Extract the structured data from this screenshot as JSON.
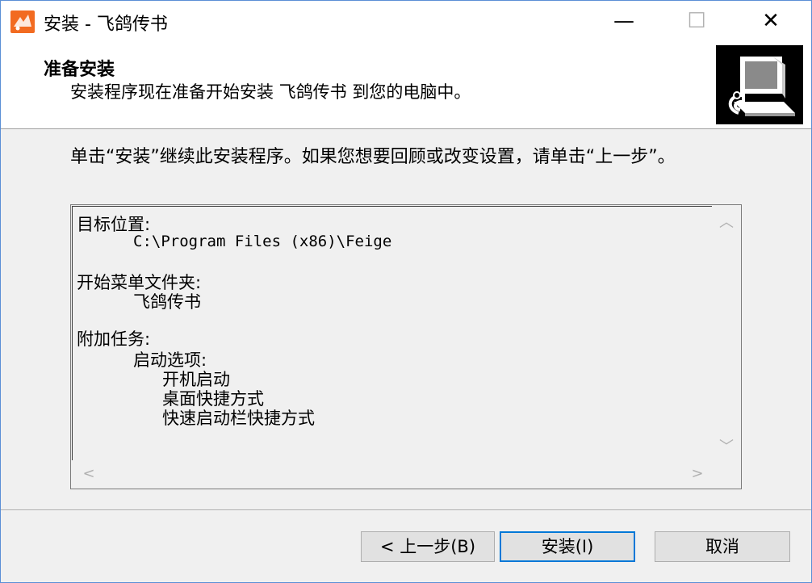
{
  "window": {
    "title": "安装 - 飞鸽传书",
    "minimize_glyph": "—",
    "maximize_glyph": "☐",
    "close_glyph": "✕"
  },
  "header": {
    "title": "准备安装",
    "subtitle": "安装程序现在准备开始安装 飞鸽传书 到您的电脑中。"
  },
  "instruction": "单击“安装”继续此安装程序。如果您想要回顾或改变设置，请单击“上一步”。",
  "memo": {
    "destination_label": "目标位置:",
    "destination_value": "C:\\Program Files (x86)\\Feige",
    "start_menu_label": "开始菜单文件夹:",
    "start_menu_value": "飞鸽传书",
    "tasks_label": "附加任务:",
    "tasks_group": "启动选项:",
    "tasks": [
      "开机启动",
      "桌面快捷方式",
      "快速启动栏快捷方式"
    ]
  },
  "buttons": {
    "back": "< 上一步(B)",
    "install": "安装(I)",
    "cancel": "取消"
  },
  "colors": {
    "app_icon": "#f26b21",
    "focus_border": "#0078d7",
    "window_border": "#5b8fd6"
  },
  "icons": {
    "app": "feige-app-icon",
    "setup": "setup-computer-icon"
  }
}
